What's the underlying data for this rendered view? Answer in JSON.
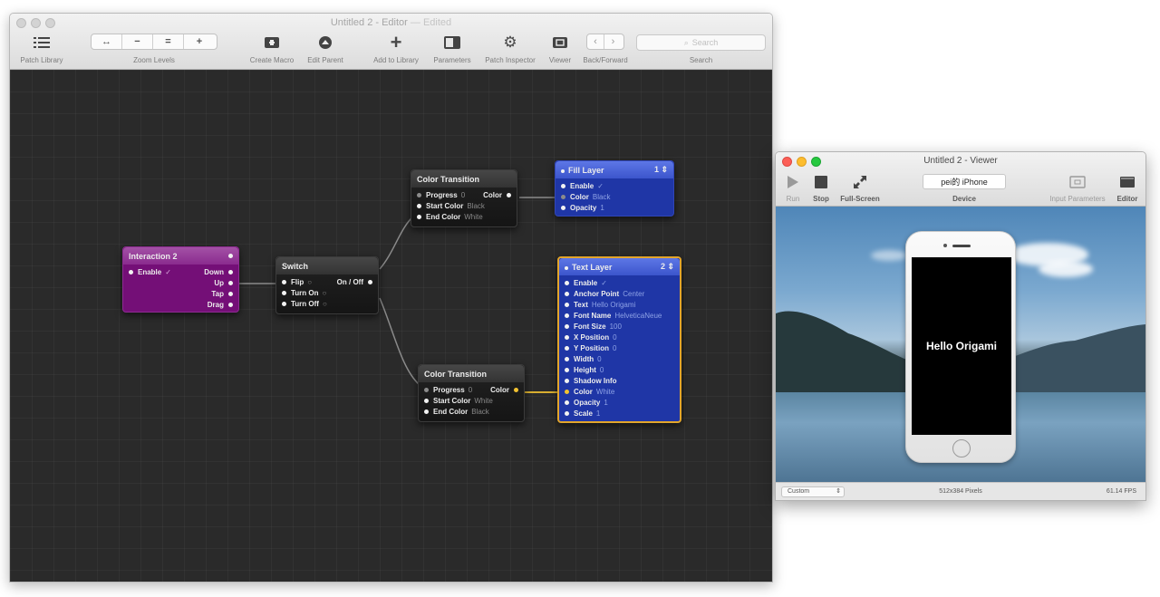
{
  "editor": {
    "title": "Untitled 2 - Editor",
    "title_suffix": "— Edited",
    "toolbar": {
      "patch_library": "Patch Library",
      "zoom_buttons": [
        "↔",
        "−",
        "=",
        "+"
      ],
      "zoom_levels": "Zoom Levels",
      "create_macro": "Create Macro",
      "edit_parent": "Edit Parent",
      "add_to_library": "Add to Library",
      "parameters": "Parameters",
      "patch_inspector": "Patch Inspector",
      "viewer": "Viewer",
      "nav_buttons": [
        "‹",
        "›"
      ],
      "back_forward": "Back/Forward",
      "search_placeholder": "Search",
      "search_label": "Search"
    }
  },
  "patches": {
    "interaction": {
      "title": "Interaction 2",
      "enable_label": "Enable",
      "enable_value": "✓",
      "outputs": [
        "Down",
        "Up",
        "Tap",
        "Drag"
      ]
    },
    "switch": {
      "title": "Switch",
      "inputs": [
        {
          "label": "Flip",
          "value": "○"
        },
        {
          "label": "Turn On",
          "value": "○"
        },
        {
          "label": "Turn Off",
          "value": "○"
        }
      ],
      "output": "On / Off"
    },
    "color_transition_1": {
      "title": "Color Transition",
      "inputs": [
        {
          "label": "Progress",
          "value": "0"
        },
        {
          "label": "Start Color",
          "value": "Black"
        },
        {
          "label": "End Color",
          "value": "White"
        }
      ],
      "output": "Color"
    },
    "color_transition_2": {
      "title": "Color Transition",
      "inputs": [
        {
          "label": "Progress",
          "value": "0"
        },
        {
          "label": "Start Color",
          "value": "White"
        },
        {
          "label": "End Color",
          "value": "Black"
        }
      ],
      "output": "Color"
    },
    "fill_layer": {
      "title": "Fill Layer",
      "index": "1 ⇕",
      "inputs": [
        {
          "label": "Enable",
          "value": "✓"
        },
        {
          "label": "Color",
          "value": "Black"
        },
        {
          "label": "Opacity",
          "value": "1"
        }
      ]
    },
    "text_layer": {
      "title": "Text Layer",
      "index": "2 ⇕",
      "inputs": [
        {
          "label": "Enable",
          "value": "✓"
        },
        {
          "label": "Anchor Point",
          "value": "Center"
        },
        {
          "label": "Text",
          "value": "Hello Origami"
        },
        {
          "label": "Font Name",
          "value": "HelveticaNeue"
        },
        {
          "label": "Font Size",
          "value": "100"
        },
        {
          "label": "X Position",
          "value": "0"
        },
        {
          "label": "Y Position",
          "value": "0"
        },
        {
          "label": "Width",
          "value": "0"
        },
        {
          "label": "Height",
          "value": "0"
        },
        {
          "label": "Shadow Info",
          "value": ""
        },
        {
          "label": "Color",
          "value": "White"
        },
        {
          "label": "Opacity",
          "value": "1"
        },
        {
          "label": "Scale",
          "value": "1"
        }
      ]
    }
  },
  "viewer": {
    "title": "Untitled 2 - Viewer",
    "run": "Run",
    "stop": "Stop",
    "fullscreen": "Full-Screen",
    "device_value": "pei的 iPhone",
    "device_label": "Device",
    "input_parameters": "Input Parameters",
    "editor": "Editor",
    "phone_text": "Hello Origami",
    "size_select": "Custom",
    "pixels": "512x384 Pixels",
    "fps": "61.14 FPS"
  },
  "colors": {
    "canvas": "#2a2a2a",
    "interaction_patch": "#740f77",
    "layer_patch": "#1f36a6",
    "selection": "#e2a52b",
    "active_wire": "#f2c231"
  }
}
